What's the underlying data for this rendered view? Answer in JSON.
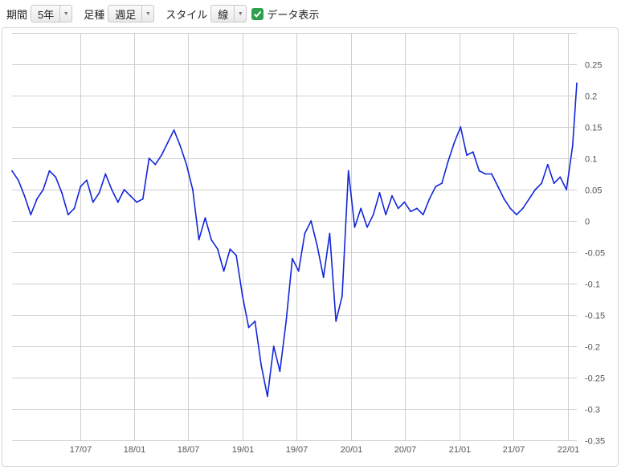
{
  "toolbar": {
    "period_label": "期間",
    "period_value": "5年",
    "interval_label": "足種",
    "interval_value": "週足",
    "style_label": "スタイル",
    "style_value": "線",
    "show_data_label": "データ表示",
    "show_data_checked": true
  },
  "colors": {
    "line": "#1226d8",
    "grid": "#cfcfcf",
    "axis_text": "#555555",
    "checkbox": "#2e9e4f"
  },
  "chart_data": {
    "type": "line",
    "title": "",
    "xlabel": "",
    "ylabel": "",
    "grid": true,
    "y_axis_side": "right",
    "ylim": [
      -0.35,
      0.3
    ],
    "yticks": [
      0.25,
      0.2,
      0.15,
      0.1,
      0.05,
      0,
      -0.05,
      -0.1,
      -0.15,
      -0.2,
      -0.25,
      -0.3,
      -0.35
    ],
    "ytick_labels": [
      "0.25",
      "0.2",
      "0.15",
      "0.1",
      "0.05",
      "0",
      "-0.05",
      "-0.1",
      "-0.15",
      "-0.2",
      "-0.25",
      "-0.3",
      "-0.35"
    ],
    "xlim": [
      "2016-11-14",
      "2022-01-31"
    ],
    "xticks": [
      "2017-07-01",
      "2018-01-01",
      "2018-07-01",
      "2019-01-01",
      "2019-07-01",
      "2020-01-01",
      "2020-07-01",
      "2021-01-01",
      "2021-07-01",
      "2022-01-01"
    ],
    "xtick_labels": [
      "17/07",
      "18/01",
      "18/07",
      "19/01",
      "19/07",
      "20/01",
      "20/07",
      "21/01",
      "21/07",
      "22/01"
    ],
    "series": [
      {
        "x": [
          "2016-11-14",
          "2016-12-05",
          "2016-12-26",
          "2017-01-16",
          "2017-02-06",
          "2017-02-27",
          "2017-03-20",
          "2017-04-10",
          "2017-05-01",
          "2017-05-22",
          "2017-06-12",
          "2017-07-03",
          "2017-07-24",
          "2017-08-14",
          "2017-09-04",
          "2017-09-25",
          "2017-10-16",
          "2017-11-06",
          "2017-11-27",
          "2017-12-18",
          "2018-01-08",
          "2018-01-29",
          "2018-02-19",
          "2018-03-12",
          "2018-04-02",
          "2018-04-23",
          "2018-05-14",
          "2018-06-04",
          "2018-06-25",
          "2018-07-16",
          "2018-08-06",
          "2018-08-27",
          "2018-09-17",
          "2018-10-08",
          "2018-10-29",
          "2018-11-19",
          "2018-12-10",
          "2018-12-31",
          "2019-01-21",
          "2019-02-11",
          "2019-03-04",
          "2019-03-25",
          "2019-04-15",
          "2019-05-06",
          "2019-05-27",
          "2019-06-17",
          "2019-07-08",
          "2019-07-29",
          "2019-08-19",
          "2019-09-09",
          "2019-09-30",
          "2019-10-21",
          "2019-11-11",
          "2019-12-02",
          "2019-12-23",
          "2020-01-13",
          "2020-02-03",
          "2020-02-24",
          "2020-03-16",
          "2020-04-06",
          "2020-04-27",
          "2020-05-18",
          "2020-06-08",
          "2020-06-29",
          "2020-07-20",
          "2020-08-10",
          "2020-08-31",
          "2020-09-21",
          "2020-10-12",
          "2020-11-02",
          "2020-11-23",
          "2020-12-14",
          "2021-01-04",
          "2021-01-25",
          "2021-02-15",
          "2021-03-08",
          "2021-03-29",
          "2021-04-19",
          "2021-05-10",
          "2021-05-31",
          "2021-06-21",
          "2021-07-12",
          "2021-08-02",
          "2021-08-23",
          "2021-09-13",
          "2021-10-04",
          "2021-10-25",
          "2021-11-15",
          "2021-12-06",
          "2021-12-27",
          "2022-01-17",
          "2022-01-31"
        ],
        "values": [
          0.08,
          0.065,
          0.04,
          0.01,
          0.035,
          0.05,
          0.08,
          0.07,
          0.045,
          0.01,
          0.02,
          0.055,
          0.065,
          0.03,
          0.045,
          0.075,
          0.05,
          0.03,
          0.05,
          0.04,
          0.03,
          0.035,
          0.1,
          0.09,
          0.105,
          0.125,
          0.145,
          0.12,
          0.09,
          0.05,
          -0.03,
          0.005,
          -0.03,
          -0.045,
          -0.08,
          -0.045,
          -0.055,
          -0.12,
          -0.17,
          -0.16,
          -0.23,
          -0.28,
          -0.2,
          -0.24,
          -0.16,
          -0.06,
          -0.08,
          -0.02,
          0,
          -0.04,
          -0.09,
          -0.02,
          -0.16,
          -0.12,
          0.08,
          -0.01,
          0.02,
          -0.01,
          0.01,
          0.045,
          0.01,
          0.04,
          0.02,
          0.03,
          0.015,
          0.02,
          0.01,
          0.035,
          0.055,
          0.06,
          0.095,
          0.125,
          0.15,
          0.105,
          0.11,
          0.08,
          0.075,
          0.075,
          0.055,
          0.035,
          0.02,
          0.01,
          0.02,
          0.035,
          0.05,
          0.06,
          0.09,
          0.06,
          0.07,
          0.05,
          0.12,
          0.22
        ]
      }
    ]
  }
}
